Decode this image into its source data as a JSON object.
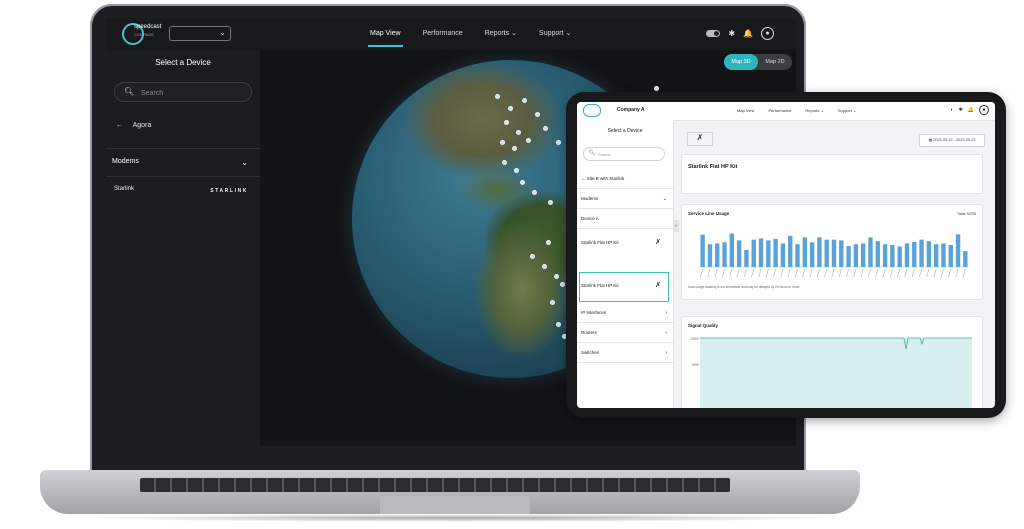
{
  "laptop": {
    "logo": {
      "main": "speedcast",
      "sub": "COMPASS"
    },
    "nav": [
      "Map View",
      "Performance",
      "Reports",
      "Support"
    ],
    "nav_active": "Map View",
    "chevron": "⌄",
    "sidebar": {
      "title": "Select a Device",
      "search_placeholder": "Search",
      "back_label": "Agora",
      "group_label": "Modems",
      "device_name": "Starlink",
      "device_brand": "STARLINK"
    },
    "map_toggle": {
      "option_3d": "Map 3D",
      "option_2d": "Map 2D",
      "active": "Map 3D"
    },
    "icons": {
      "search": "search-icon",
      "bell": "bell-icon",
      "user": "user-icon",
      "bug": "bug-icon"
    }
  },
  "tablet": {
    "company": "Company A",
    "nav": [
      "Map View",
      "Performance",
      "Reports",
      "Support"
    ],
    "sidebar": {
      "title": "Select a Device",
      "search_placeholder": "Search",
      "site": "Site B with Starlink",
      "modems_label": "Modems",
      "devices": [
        "Device A",
        "Starlink Flat HP Kit",
        "Starlink Flat HP Kit"
      ],
      "groups": [
        "IP Interfaces",
        "Routers",
        "Switches"
      ]
    },
    "date_range": "2023-05-22 - 2023-05-23",
    "kit_title": "Starlink Flat HP Kit",
    "service_card": {
      "title": "Service Line Usage",
      "total": "Total 34TB",
      "note": "Data usage tracking is not immediate and may be delayed by 24 hours or more."
    },
    "signal_card": {
      "title": "Signal Quality",
      "y_labels": [
        "100%",
        "50%"
      ]
    }
  },
  "chart_data": {
    "type": "bar",
    "title": "Service Line Usage",
    "values": [
      0.85,
      0.6,
      0.62,
      0.65,
      0.88,
      0.7,
      0.45,
      0.72,
      0.75,
      0.7,
      0.74,
      0.62,
      0.82,
      0.6,
      0.78,
      0.65,
      0.78,
      0.72,
      0.72,
      0.7,
      0.55,
      0.6,
      0.62,
      0.78,
      0.68,
      0.6,
      0.58,
      0.54,
      0.62,
      0.66,
      0.72,
      0.68,
      0.6,
      0.62,
      0.58,
      0.86,
      0.42
    ]
  }
}
